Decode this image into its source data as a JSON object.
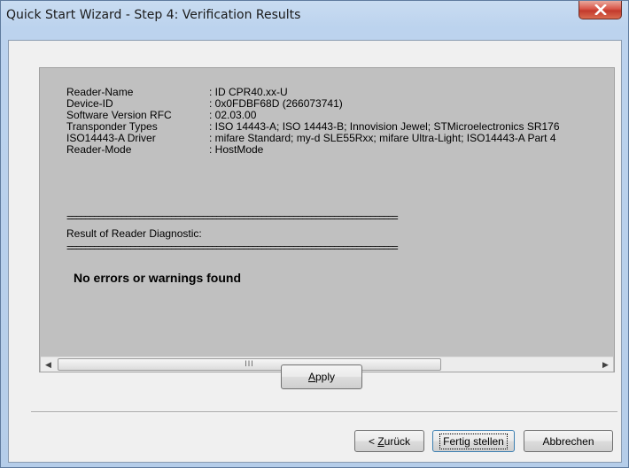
{
  "window": {
    "title": "Quick Start Wizard - Step 4: Verification Results",
    "close_icon": "close-icon"
  },
  "results": {
    "fields": [
      {
        "label": "Reader-Name",
        "value": ": ID CPR40.xx-U"
      },
      {
        "label": "Device-ID",
        "value": ": 0x0FDBF68D (266073741)"
      },
      {
        "label": "Software Version RFC",
        "value": ": 02.03.00"
      },
      {
        "label": "Transponder Types",
        "value": ": ISO 14443-A; ISO 14443-B; Innovision Jewel; STMicroelectronics SR176"
      },
      {
        "label": "ISO14443-A Driver",
        "value": ": mifare Standard; my-d SLE55Rxx; mifare Ultra-Light; ISO14443-A Part 4"
      },
      {
        "label": "Reader-Mode",
        "value": ": HostMode"
      }
    ],
    "separator": "=========================================================================",
    "diagnostic_title": "Result of Reader Diagnostic:",
    "message": "No errors or warnings found"
  },
  "scrollbar": {
    "left_arrow": "◀",
    "right_arrow": "▶",
    "thumb_grip": "III"
  },
  "buttons": {
    "apply_mnemonic": "A",
    "apply_rest": "pply",
    "back_prefix": "< ",
    "back_mnemonic": "Z",
    "back_rest": "urück",
    "finish": "Fertig stellen",
    "cancel": "Abbrechen"
  }
}
